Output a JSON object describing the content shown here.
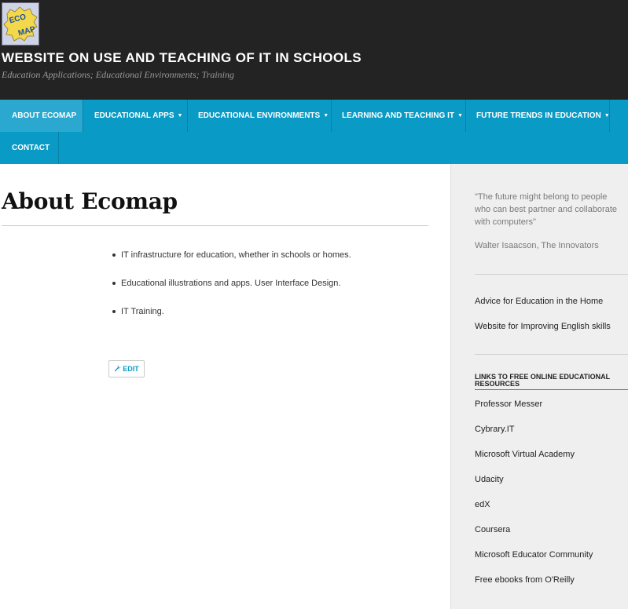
{
  "site": {
    "title": "WEBSITE ON USE AND TEACHING OF IT IN SCHOOLS",
    "tagline": "Education Applications; Educational Environments; Training",
    "logo_text_top": "ECO",
    "logo_text_bottom": "MAP"
  },
  "nav": {
    "items": [
      {
        "label": "ABOUT ECOMAP",
        "has_dropdown": false,
        "active": true
      },
      {
        "label": "EDUCATIONAL APPS",
        "has_dropdown": true
      },
      {
        "label": "EDUCATIONAL ENVIRONMENTS",
        "has_dropdown": true
      },
      {
        "label": "LEARNING AND TEACHING IT",
        "has_dropdown": true
      },
      {
        "label": "FUTURE TRENDS IN EDUCATION",
        "has_dropdown": true
      },
      {
        "label": "CONTACT",
        "has_dropdown": false
      }
    ],
    "caret": "▼"
  },
  "main": {
    "title": "About Ecomap",
    "bullets": [
      "IT infrastructure for education, whether in schools or homes.",
      "Educational illustrations and apps. User Interface Design.",
      "IT Training."
    ],
    "edit_label": "EDIT"
  },
  "sidebar": {
    "quote": "\"The future might belong to people who can best partner and collaborate with computers\"",
    "quote_author": "Walter Isaacson, The Innovators",
    "pages": [
      "Advice for Education in the Home",
      "Website for Improving English skills"
    ],
    "links_title": "LINKS TO FREE ONLINE EDUCATIONAL RESOURCES",
    "links": [
      "Professor Messer",
      "Cybrary.IT",
      "Microsoft Virtual Academy",
      "Udacity",
      "edX",
      "Coursera",
      "Microsoft Educator Community",
      "Free ebooks from O'Reilly"
    ]
  },
  "colors": {
    "header_bg": "#232323",
    "nav_bg": "#0a9ac6",
    "nav_active": "#2aa8d0",
    "sidebar_bg": "#efefef",
    "accent": "#0a9ac6"
  },
  "icons": {
    "edit": "wrench-icon",
    "dropdown": "caret-down-icon"
  }
}
